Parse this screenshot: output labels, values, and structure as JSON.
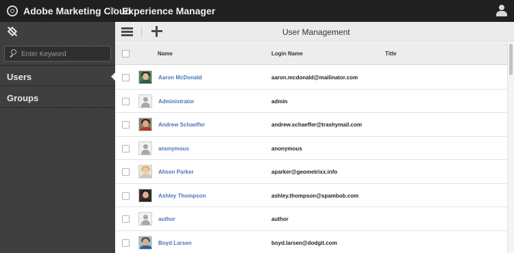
{
  "header": {
    "brand": "Adobe Marketing Cloud",
    "separator": ">",
    "product": "Experience Manager",
    "icons": {
      "logo": "adobe-marketing-cloud-logo",
      "user": "user-profile-icon"
    }
  },
  "sidebar": {
    "rail_icon": "navigation-rail-icon",
    "search": {
      "placeholder": "Enter Keyword",
      "value": ""
    },
    "items": [
      {
        "label": "Users",
        "active": true
      },
      {
        "label": "Groups",
        "active": false
      }
    ]
  },
  "toolbar": {
    "title": "User Management",
    "icons": {
      "menu": "list-view-icon",
      "add": "add-icon"
    }
  },
  "table": {
    "columns": [
      "Name",
      "Login Name",
      "Title"
    ],
    "rows": [
      {
        "name": "Aaron McDonald",
        "login": "aaron.mcdonald@mailinator.com",
        "title": "",
        "avatar": "photo"
      },
      {
        "name": "Administrator",
        "login": "admin",
        "title": "",
        "avatar": "default"
      },
      {
        "name": "Andrew Schaeffer",
        "login": "andrew.schaeffer@trashymail.com",
        "title": "",
        "avatar": "photo"
      },
      {
        "name": "anonymous",
        "login": "anonymous",
        "title": "",
        "avatar": "default"
      },
      {
        "name": "Alison Parker",
        "login": "aparker@geometrixx.info",
        "title": "",
        "avatar": "photo"
      },
      {
        "name": "Ashley Thompson",
        "login": "ashley.thompson@spambob.com",
        "title": "",
        "avatar": "photo"
      },
      {
        "name": "author",
        "login": "author",
        "title": "",
        "avatar": "default"
      },
      {
        "name": "Boyd Larsen",
        "login": "boyd.larsen@dodgit.com",
        "title": "",
        "avatar": "photo"
      }
    ]
  },
  "colors": {
    "header_bg": "#202020",
    "sidebar_bg": "#3d3d3d",
    "link": "#4a76b8",
    "toolbar_bg": "#ebebeb"
  }
}
